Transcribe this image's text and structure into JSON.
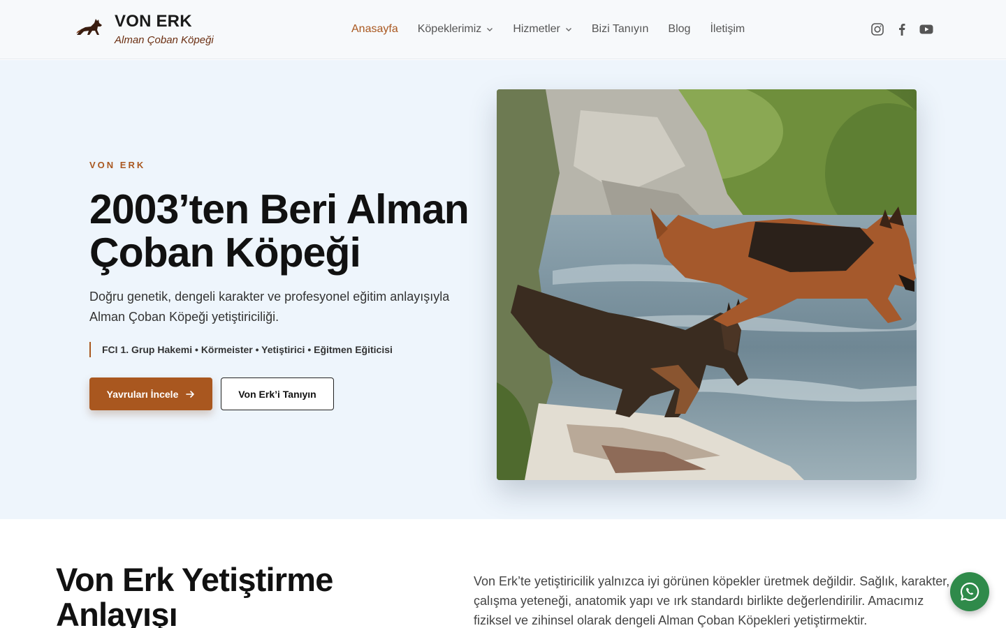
{
  "header": {
    "logo_title": "VON ERK",
    "logo_subtitle": "Alman Çoban Köpeği",
    "nav": [
      {
        "label": "Anasayfa",
        "active": true,
        "dropdown": false
      },
      {
        "label": "Köpeklerimiz",
        "active": false,
        "dropdown": true
      },
      {
        "label": "Hizmetler",
        "active": false,
        "dropdown": true
      },
      {
        "label": "Bizi Tanıyın",
        "active": false,
        "dropdown": false
      },
      {
        "label": "Blog",
        "active": false,
        "dropdown": false
      },
      {
        "label": "İletişim",
        "active": false,
        "dropdown": false
      }
    ],
    "social_icons": [
      "instagram-icon",
      "facebook-icon",
      "youtube-icon"
    ]
  },
  "hero": {
    "eyebrow": "VON ERK",
    "title_line1": "2003’ten Beri Alman",
    "title_line2": "Çoban Köpeği",
    "desc_line1": "Doğru genetik, dengeli karakter ve profesyonel eğitim anlayışıyla",
    "desc_line2": "Alman Çoban Köpeği yetiştiriciliği.",
    "tags": "FCI 1. Grup Hakemi • Körmeister • Yetiştirici • Eğitmen Eğiticisi",
    "primary_button": "Yavruları İncele",
    "secondary_button": "Von Erk’i Tanıyın"
  },
  "section2": {
    "title_line1": "Von Erk Yetiştirme",
    "title_line2": "Anlayışı",
    "text_line1": "Von Erk’te yetiştiricilik yalnızca iyi görünen köpekler üretmek değildir. Sağlık, karakter,",
    "text_line2": "çalışma yeteneği, anatomik yapı ve ırk standardı birlikte değerlendirilir. Amacımız",
    "text_line3": "fiziksel ve zihinsel olarak dengeli Alman Çoban Köpekleri yetiştirmektir."
  },
  "colors": {
    "accent": "#a9571f",
    "hero_bg": "#eef5fc",
    "whatsapp": "#2f8a4a"
  }
}
